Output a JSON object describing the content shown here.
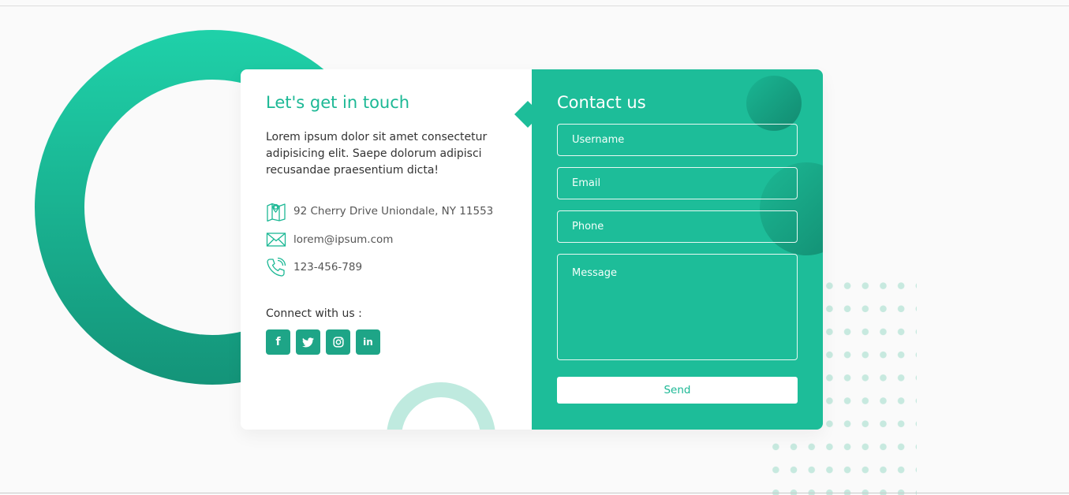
{
  "info": {
    "title": "Let's get in touch",
    "text": "Lorem ipsum dolor sit amet consectetur adipisicing elit. Saepe dolorum adipisci recusandae praesentium dicta!",
    "address": "92 Cherry Drive Uniondale, NY 11553",
    "email": "lorem@ipsum.com",
    "phone": "123-456-789",
    "connect_label": "Connect with us :",
    "socials": [
      {
        "name": "facebook",
        "glyph": "f"
      },
      {
        "name": "twitter",
        "glyph": "twitter"
      },
      {
        "name": "instagram",
        "glyph": "instagram"
      },
      {
        "name": "linkedin",
        "glyph": "in"
      }
    ]
  },
  "form": {
    "title": "Contact us",
    "username_placeholder": "Username",
    "email_placeholder": "Email",
    "phone_placeholder": "Phone",
    "message_placeholder": "Message",
    "send_label": "Send"
  },
  "colors": {
    "accent": "#1dbd99",
    "accent_dark": "#149479",
    "social_bg": "#1ea587",
    "ring_light": "#bfeadf"
  }
}
